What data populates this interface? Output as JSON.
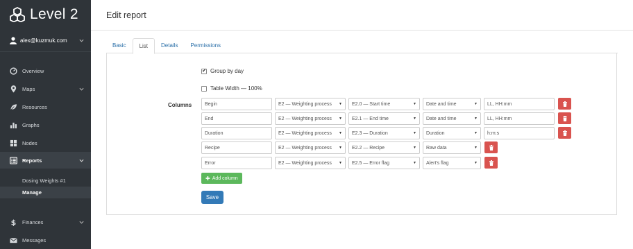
{
  "brand": {
    "title": "Level 2"
  },
  "user": {
    "email": "alex@kuzmuk.com"
  },
  "nav": {
    "items": [
      {
        "label": "Overview",
        "icon": "dashboard-icon"
      },
      {
        "label": "Maps",
        "icon": "map-marker-icon",
        "has_chevron": true
      },
      {
        "label": "Resources",
        "icon": "leaf-icon"
      },
      {
        "label": "Graphs",
        "icon": "bar-chart-icon"
      },
      {
        "label": "Nodes",
        "icon": "grid-icon"
      },
      {
        "label": "Reports",
        "icon": "list-alt-icon",
        "has_chevron": true,
        "active": true
      }
    ],
    "sub_items": [
      {
        "label": "Dosing Weights #1"
      },
      {
        "label": "Manage",
        "active": true
      }
    ],
    "bottom_items": [
      {
        "label": "Finances",
        "icon": "dollar-icon",
        "has_chevron": true
      },
      {
        "label": "Messages",
        "icon": "envelope-icon"
      }
    ]
  },
  "page": {
    "title": "Edit report"
  },
  "tabs": [
    {
      "label": "Basic"
    },
    {
      "label": "List",
      "active": true
    },
    {
      "label": "Details"
    },
    {
      "label": "Permissions"
    }
  ],
  "form": {
    "group_by_day": {
      "label": "Group by day",
      "checked": true
    },
    "table_width": {
      "label": "Table Width — 100%",
      "checked": false
    },
    "columns_label": "Columns",
    "rows": [
      {
        "name": "Begin",
        "process": "E2 — Weighting process",
        "field": "E2.0 — Start time",
        "type": "Date and time",
        "format": "LL, HH:mm"
      },
      {
        "name": "End",
        "process": "E2 — Weighting process",
        "field": "E2.1 — End time",
        "type": "Date and time",
        "format": "LL, HH:mm"
      },
      {
        "name": "Duration",
        "process": "E2 — Weighting process",
        "field": "E2.3 — Duration",
        "type": "Duration",
        "format": "h:m:s"
      },
      {
        "name": "Recipe",
        "process": "E2 — Weighting process",
        "field": "E2.2 — Recipe",
        "type": "Raw data",
        "format": null
      },
      {
        "name": "Error",
        "process": "E2 — Weighting process",
        "field": "E2.5 — Error flag",
        "type": "Alert's flag",
        "format": null
      }
    ],
    "add_column_label": "Add column",
    "save_label": "Save"
  },
  "colors": {
    "sidebar_bg": "#2f3439",
    "link": "#2a6fa8",
    "danger": "#d9534f",
    "success": "#5cb85c",
    "primary": "#337ab7"
  }
}
